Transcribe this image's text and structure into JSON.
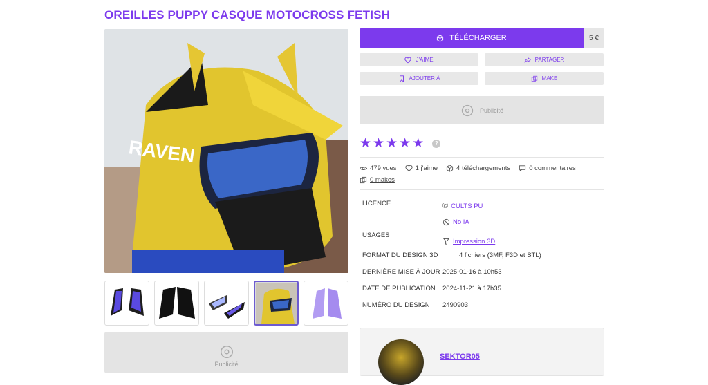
{
  "page_title": "OREILLES PUPPY CASQUE MOTOCROSS FETISH",
  "download": {
    "label": "TÉLÉCHARGER",
    "price": "5 €"
  },
  "actions": {
    "like": "J'AIME",
    "share": "PARTAGER",
    "add_to": "AJOUTER À",
    "make": "MAKE"
  },
  "ad": {
    "label": "Publicité",
    "label_left": "Publicité"
  },
  "rating": {
    "stars": 5,
    "help": "?"
  },
  "stats": {
    "views": "479 vues",
    "likes": "1 j'aime",
    "downloads": "4 téléchargements",
    "comments": "0 commentaires",
    "makes": "0 makes"
  },
  "details": {
    "licence_label": "LICENCE",
    "licence_value": "CULTS PU",
    "ai_value": "No IA",
    "usages_label": "USAGES",
    "usages_value": "Impression 3D",
    "format_label": "FORMAT DU DESIGN 3D",
    "format_value": "4 fichiers (3MF, F3D et STL)",
    "update_label": "DERNIÈRE MISE À JOUR",
    "update_value": "2025-01-16 à 10h53",
    "pub_label": "DATE DE PUBLICATION",
    "pub_value": "2024-11-21 à 17h35",
    "number_label": "NUMÉRO DU DESIGN",
    "number_value": "2490903"
  },
  "author": {
    "name": "SEKTOR05"
  },
  "colors": {
    "accent": "#7c3aed",
    "ad_bg": "#e4e4e4"
  }
}
